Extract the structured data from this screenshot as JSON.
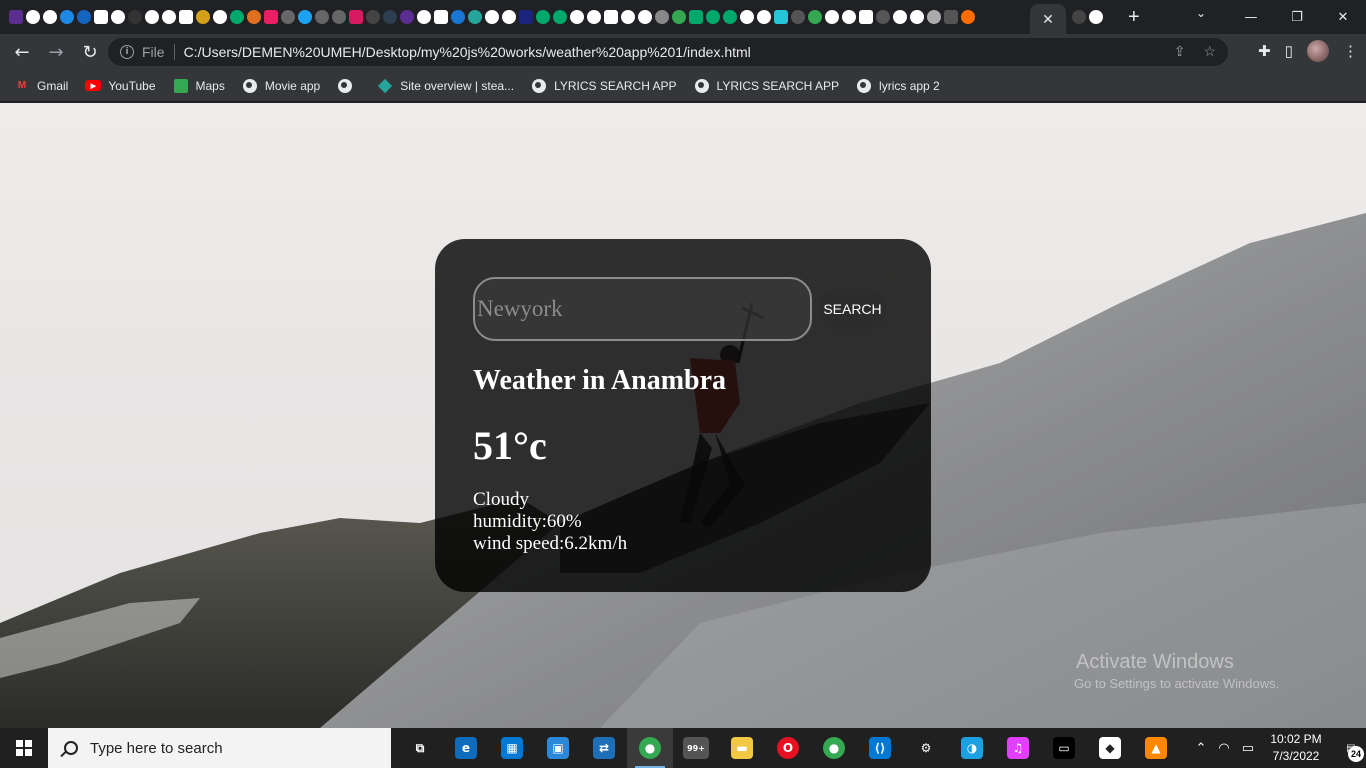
{
  "browser": {
    "tab_favicon_colors": [
      "#5c2d91",
      "#ffffff",
      "#ffffff",
      "#1e88e5",
      "#1565c0",
      "#ffffff",
      "#ffffff",
      "#333333",
      "#ffffff",
      "#ffffff",
      "#ffffff",
      "#d4a017",
      "#ffffff",
      "#00a86b",
      "#e07020",
      "#e91e63",
      "#666666",
      "#1da1f2",
      "#666666",
      "#666666",
      "#d81b60",
      "#444444",
      "#2c3e50",
      "#5c2d91",
      "#ffffff",
      "#ffffff",
      "#1976d2",
      "#26a69a",
      "#ffffff",
      "#ffffff",
      "#1a237e",
      "#00a86b",
      "#00a86b",
      "#ffffff",
      "#ffffff",
      "#ffffff",
      "#ffffff",
      "#ffffff",
      "#888888",
      "#34a853",
      "#00a86b",
      "#00a86b",
      "#00a86b",
      "#ffffff",
      "#ffffff",
      "#26c6da",
      "#555555",
      "#34a853",
      "#ffffff",
      "#ffffff",
      "#ffffff",
      "#555555",
      "#ffffff",
      "#ffffff",
      "#aaaaaa",
      "#555555",
      "#ff6d00"
    ],
    "active_tab_close": "✕",
    "new_tab_label": "+",
    "tab_search_icon": "chevron-down-icon",
    "window_controls": {
      "minimize": "—",
      "maximize": "❐",
      "close": "✕"
    },
    "nav": {
      "back": "←",
      "forward": "→",
      "reload": "↻"
    },
    "omnibox": {
      "info_icon": "i",
      "scheme_label": "File",
      "url": "C:/Users/DEMEN%20UMEH/Desktop/my%20js%20works/weather%20app%201/index.html",
      "share_icon": "⇪",
      "star_icon": "☆"
    },
    "toolbar_icons": {
      "extensions": "✚",
      "sidepanel": "▯",
      "menu": "⋮"
    },
    "bookmarks": [
      {
        "label": "Gmail",
        "icon": "gmail-icon",
        "color": "#ea4335"
      },
      {
        "label": "YouTube",
        "icon": "youtube-icon",
        "color": "#ff0000"
      },
      {
        "label": "Maps",
        "icon": "maps-icon",
        "color": "#34a853"
      },
      {
        "label": "Movie app",
        "icon": "globe-icon",
        "color": "#e8eaed"
      },
      {
        "label": "",
        "icon": "globe-icon",
        "color": "#e8eaed"
      },
      {
        "label": "Site overview | stea...",
        "icon": "diamond-icon",
        "color": "#26a69a"
      },
      {
        "label": "LYRICS SEARCH APP",
        "icon": "globe-icon",
        "color": "#e8eaed"
      },
      {
        "label": "LYRICS SEARCH APP",
        "icon": "globe-icon",
        "color": "#e8eaed"
      },
      {
        "label": "lyrics app 2",
        "icon": "globe-icon",
        "color": "#e8eaed"
      }
    ]
  },
  "weather": {
    "search_placeholder": "Newyork",
    "search_button": "SEARCH",
    "city_title": "Weather in Anambra",
    "temperature": "51°c",
    "description": "Cloudy",
    "humidity": "humidity:60%",
    "wind": "wind speed:6.2km/h"
  },
  "watermark": {
    "line1": "Activate Windows",
    "line2": "Go to Settings to activate Windows."
  },
  "taskbar": {
    "search_placeholder": "Type here to search",
    "apps": [
      {
        "name": "task-view",
        "glyph": "⧉",
        "color": "#202020"
      },
      {
        "name": "edge",
        "glyph": "e",
        "color": "#0f6cbd"
      },
      {
        "name": "store",
        "glyph": "▦",
        "color": "#0078d4"
      },
      {
        "name": "sandbox",
        "glyph": "▣",
        "color": "#2b88d8"
      },
      {
        "name": "remote-desktop",
        "glyph": "⇄",
        "color": "#1e6fb8"
      },
      {
        "name": "chrome",
        "glyph": "●",
        "color": "#34a853"
      },
      {
        "name": "mail-badge",
        "glyph": "99+",
        "color": "#555555"
      },
      {
        "name": "file-explorer",
        "glyph": "▬",
        "color": "#f2c744"
      },
      {
        "name": "opera",
        "glyph": "O",
        "color": "#e81123"
      },
      {
        "name": "chrome-2",
        "glyph": "●",
        "color": "#34a853"
      },
      {
        "name": "vscode",
        "glyph": "⟨⟩",
        "color": "#0078d4"
      },
      {
        "name": "settings",
        "glyph": "⚙",
        "color": "#202020"
      },
      {
        "name": "webstorm",
        "glyph": "◑",
        "color": "#1ba1e2"
      },
      {
        "name": "itunes",
        "glyph": "♫",
        "color": "#e040fb"
      },
      {
        "name": "terminal",
        "glyph": "▭",
        "color": "#000000"
      },
      {
        "name": "virtualbox",
        "glyph": "◆",
        "color": "#ffffff"
      },
      {
        "name": "vlc",
        "glyph": "▲",
        "color": "#ff8800"
      }
    ],
    "tray": {
      "chevron": "⌃",
      "wifi": "◠",
      "battery": "▭"
    },
    "time": "10:02 PM",
    "date": "7/3/2022",
    "notification_count": "24"
  }
}
